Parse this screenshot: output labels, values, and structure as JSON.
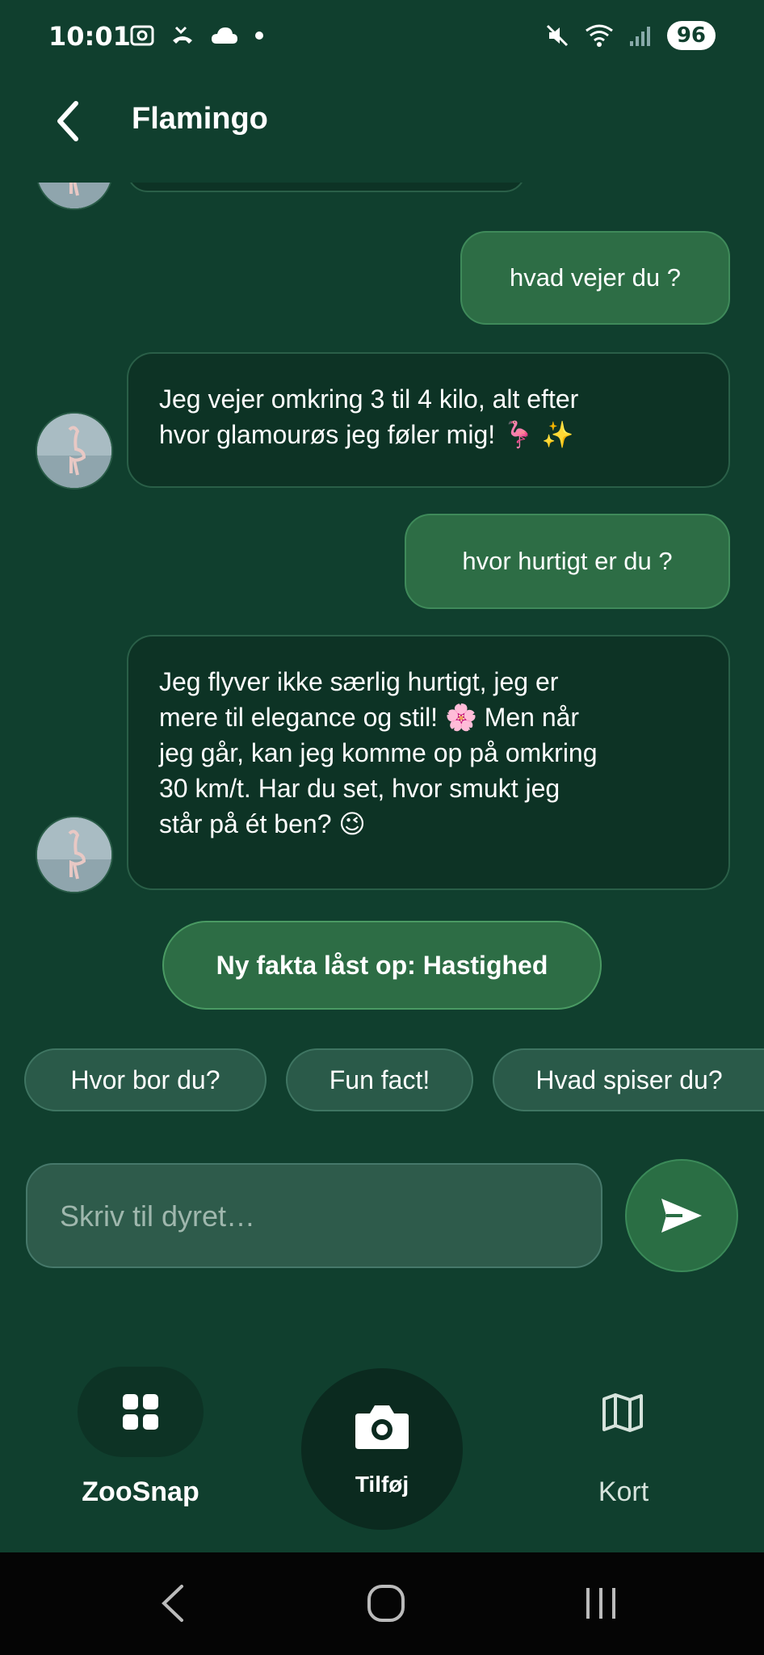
{
  "status_bar": {
    "time": "10:01",
    "battery": "96"
  },
  "header": {
    "title": "Flamingo"
  },
  "messages": [
    {
      "from": "user",
      "text": "hvad vejer du ?"
    },
    {
      "from": "bot",
      "lines": [
        "Jeg vejer omkring 3 til 4 kilo, alt efter",
        "hvor glamourøs jeg føler mig! 🦩 ✨"
      ]
    },
    {
      "from": "user",
      "text": "hvor hurtigt er du ?"
    },
    {
      "from": "bot",
      "lines": [
        "Jeg flyver ikke særlig hurtigt, jeg er",
        "mere til elegance og stil! 🌸 Men når",
        "jeg går, kan jeg komme op på omkring",
        "30 km/t. Har du set, hvor smukt jeg",
        "står på ét ben? 😉"
      ]
    }
  ],
  "unlock_banner": "Ny fakta låst op: Hastighed",
  "suggestions": [
    "Hvor bor du?",
    "Fun fact!",
    "Hvad spiser du?"
  ],
  "composer": {
    "placeholder": "Skriv til dyret…",
    "value": ""
  },
  "bottom_nav": {
    "zoosnap": "ZooSnap",
    "add": "Tilføj",
    "map": "Kort"
  },
  "colors": {
    "background": "#103f2e",
    "user_bubble": "#2d6d45",
    "bot_bubble": "#0d3325",
    "chip": "#2a5a49"
  }
}
